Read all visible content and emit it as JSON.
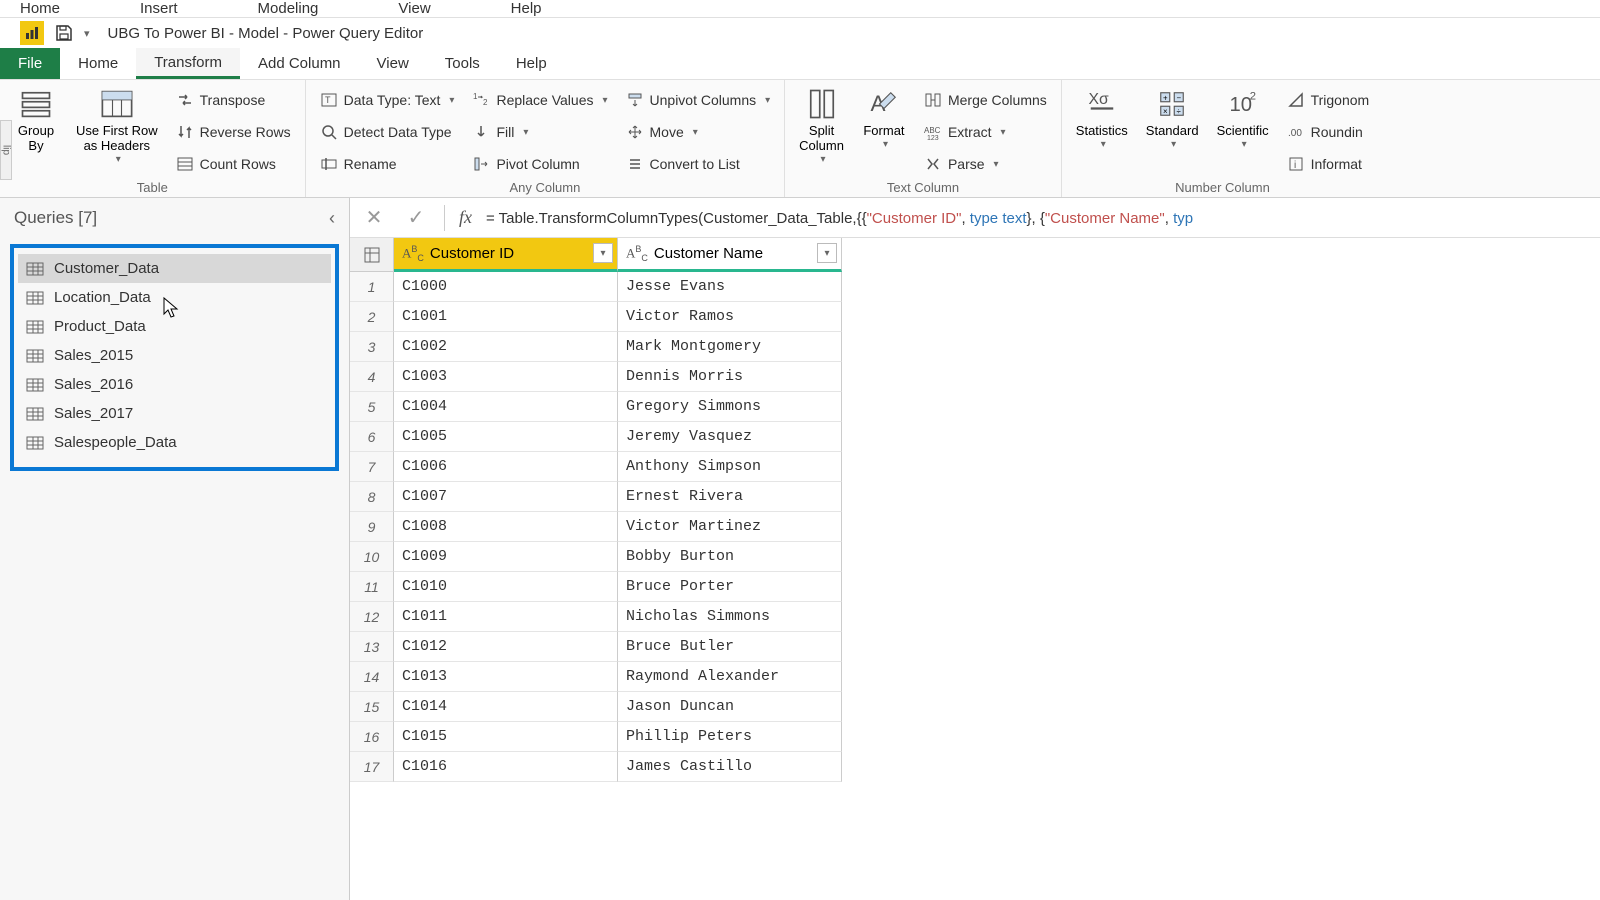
{
  "top_menu": {
    "items": [
      "Home",
      "Insert",
      "Modeling",
      "View",
      "Help"
    ]
  },
  "title": "UBG To Power BI - Model - Power Query Editor",
  "ribbon_tabs": [
    "File",
    "Home",
    "Transform",
    "Add Column",
    "View",
    "Tools",
    "Help"
  ],
  "active_ribbon_tab": "Transform",
  "ribbon": {
    "table": {
      "label": "Table",
      "group_by": "Group\nBy",
      "use_first_row": "Use First Row\nas Headers",
      "transpose": "Transpose",
      "reverse_rows": "Reverse Rows",
      "count_rows": "Count Rows"
    },
    "any_column": {
      "label": "Any Column",
      "data_type": "Data Type: Text",
      "detect_type": "Detect Data Type",
      "rename": "Rename",
      "replace_values": "Replace Values",
      "fill": "Fill",
      "pivot": "Pivot Column",
      "unpivot": "Unpivot Columns",
      "move": "Move",
      "convert_to_list": "Convert to List"
    },
    "text_column": {
      "label": "Text Column",
      "split": "Split\nColumn",
      "format": "Format",
      "merge": "Merge Columns",
      "extract": "Extract",
      "parse": "Parse"
    },
    "number_column": {
      "label": "Number Column",
      "statistics": "Statistics",
      "standard": "Standard",
      "scientific": "Scientific",
      "trig": "Trigonom",
      "rounding": "Roundin",
      "info": "Informat"
    }
  },
  "queries": {
    "header": "Queries [7]",
    "items": [
      "Customer_Data",
      "Location_Data",
      "Product_Data",
      "Sales_2015",
      "Sales_2016",
      "Sales_2017",
      "Salespeople_Data"
    ],
    "selected": 0
  },
  "formula": {
    "prefix": "= Table.TransformColumnTypes(Customer_Data_Table,{{",
    "s1": "\"Customer ID\"",
    "mid1": ", ",
    "kw1": "type text",
    "mid2": "}, {",
    "s2": "\"Customer Name\"",
    "mid3": ", ",
    "kw2": "typ"
  },
  "columns": [
    "Customer ID",
    "Customer Name"
  ],
  "rows": [
    {
      "n": 1,
      "id": "C1000",
      "name": "Jesse Evans"
    },
    {
      "n": 2,
      "id": "C1001",
      "name": "Victor Ramos"
    },
    {
      "n": 3,
      "id": "C1002",
      "name": "Mark Montgomery"
    },
    {
      "n": 4,
      "id": "C1003",
      "name": "Dennis Morris"
    },
    {
      "n": 5,
      "id": "C1004",
      "name": "Gregory Simmons"
    },
    {
      "n": 6,
      "id": "C1005",
      "name": "Jeremy Vasquez"
    },
    {
      "n": 7,
      "id": "C1006",
      "name": "Anthony Simpson"
    },
    {
      "n": 8,
      "id": "C1007",
      "name": "Ernest Rivera"
    },
    {
      "n": 9,
      "id": "C1008",
      "name": "Victor Martinez"
    },
    {
      "n": 10,
      "id": "C1009",
      "name": "Bobby Burton"
    },
    {
      "n": 11,
      "id": "C1010",
      "name": "Bruce Porter"
    },
    {
      "n": 12,
      "id": "C1011",
      "name": "Nicholas Simmons"
    },
    {
      "n": 13,
      "id": "C1012",
      "name": "Bruce Butler"
    },
    {
      "n": 14,
      "id": "C1013",
      "name": "Raymond Alexander"
    },
    {
      "n": 15,
      "id": "C1014",
      "name": "Jason Duncan"
    },
    {
      "n": 16,
      "id": "C1015",
      "name": "Phillip Peters"
    },
    {
      "n": 17,
      "id": "C1016",
      "name": "James Castillo"
    }
  ],
  "clip_label": "lip"
}
